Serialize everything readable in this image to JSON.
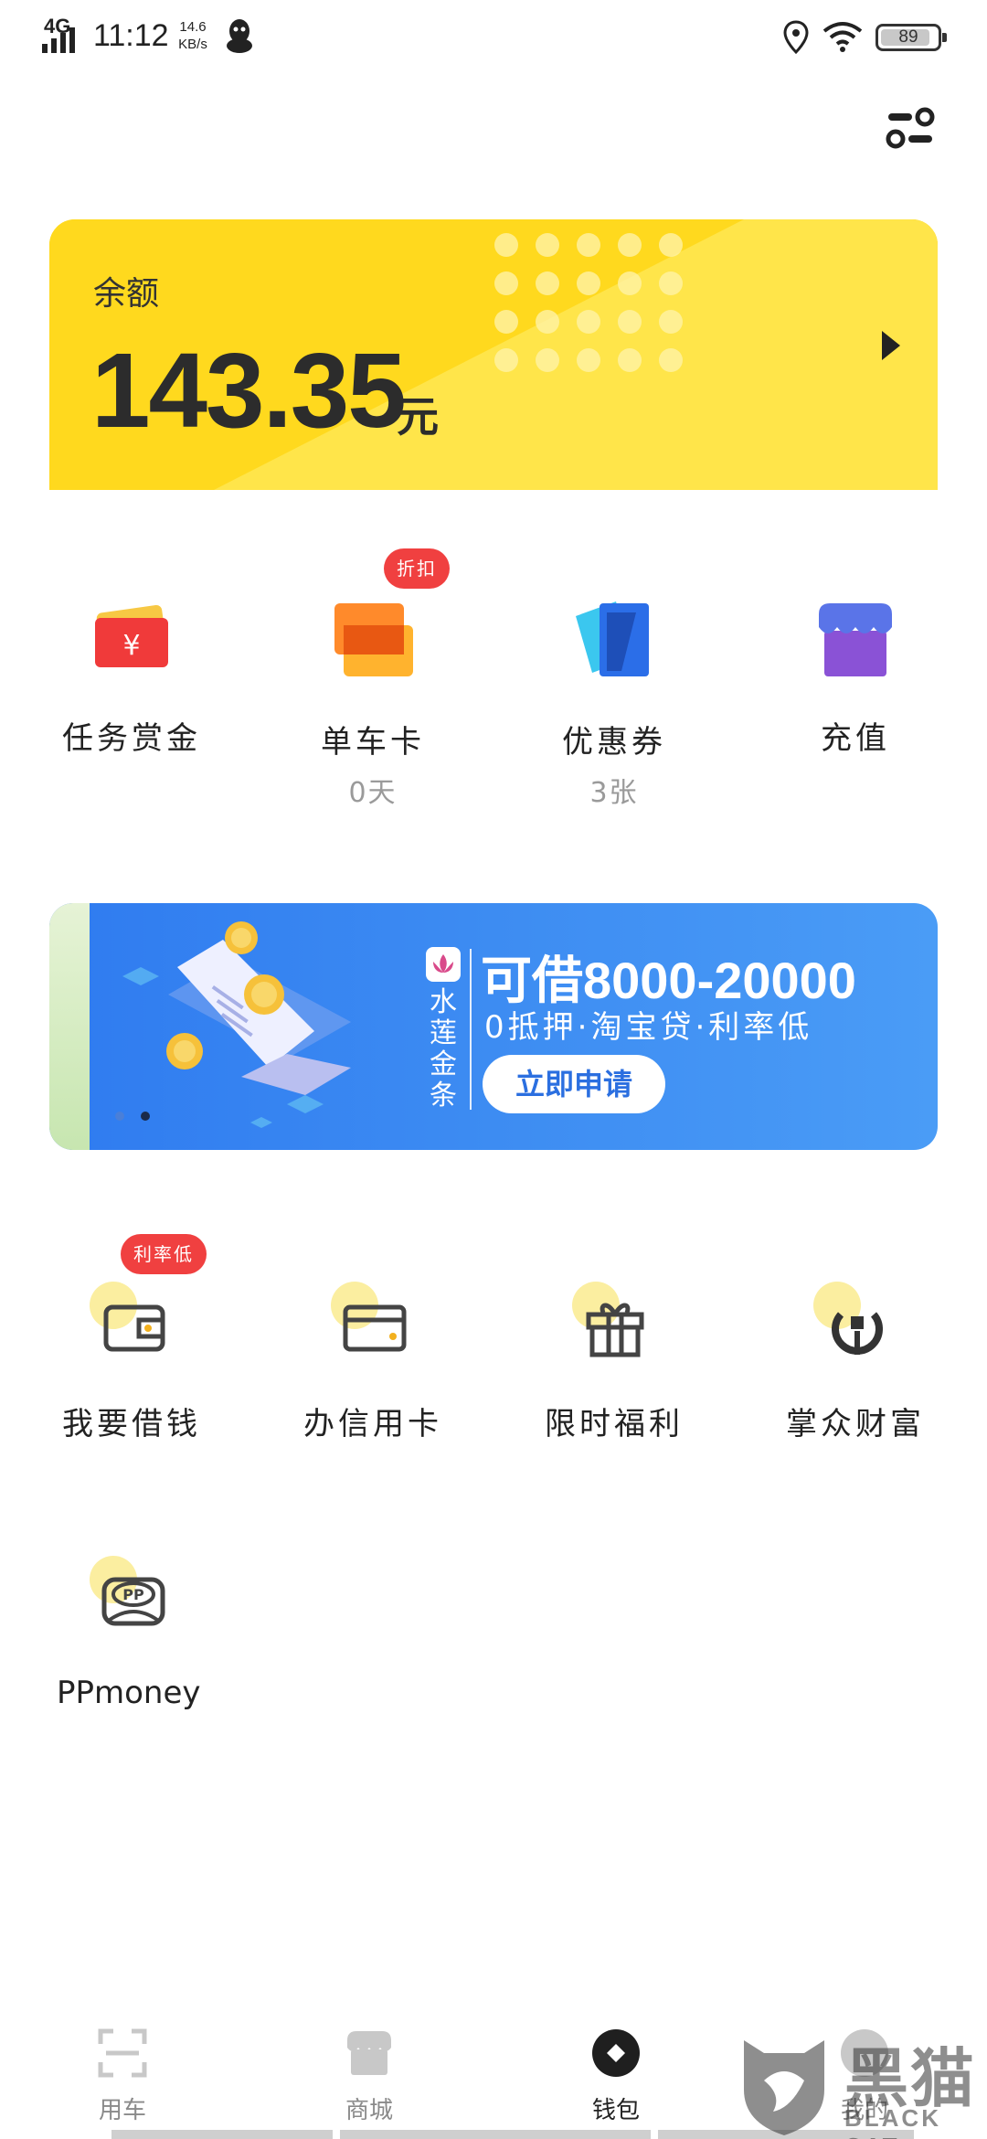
{
  "status_bar": {
    "network": "4G",
    "time": "11:12",
    "speed_value": "14.6",
    "speed_unit": "KB/s",
    "battery": "89",
    "battery_level": 0.89
  },
  "balance": {
    "label": "余额",
    "amount": "143.35",
    "unit": "元"
  },
  "quick_grid": [
    {
      "label": "任务赏金",
      "sub": "",
      "icon": "red-envelope-icon"
    },
    {
      "label": "单车卡",
      "sub": "0天",
      "badge": "折扣",
      "icon": "bike-card-icon"
    },
    {
      "label": "优惠券",
      "sub": "3张",
      "icon": "coupon-icon"
    },
    {
      "label": "充值",
      "sub": "",
      "icon": "store-icon"
    }
  ],
  "banner": {
    "brand": "水莲金条",
    "headline": "可借8000-20000",
    "subtitle": "0抵押·淘宝贷·利率低",
    "button": "立即申请"
  },
  "service_grid": [
    {
      "label": "我要借钱",
      "badge": "利率低",
      "icon": "wallet-icon"
    },
    {
      "label": "办信用卡",
      "icon": "credit-card-icon"
    },
    {
      "label": "限时福利",
      "icon": "gift-icon"
    },
    {
      "label": "掌众财富",
      "icon": "wealth-icon"
    },
    {
      "label": "PPmoney",
      "icon": "ppmoney-icon"
    }
  ],
  "bottom_nav": [
    {
      "label": "用车",
      "icon": "scan-icon"
    },
    {
      "label": "商城",
      "icon": "shop-icon"
    },
    {
      "label": "钱包",
      "icon": "wallet-nav-icon",
      "active": true
    },
    {
      "label": "我的",
      "icon": "profile-icon"
    }
  ],
  "watermark": {
    "text": "黑猫",
    "sub": "BLACK CAT"
  },
  "colors": {
    "card_yellow": "#ffd91e",
    "badge_red": "#f04040",
    "banner_blue": "#3d8cf2",
    "icon_circle": "#fbeea0"
  }
}
